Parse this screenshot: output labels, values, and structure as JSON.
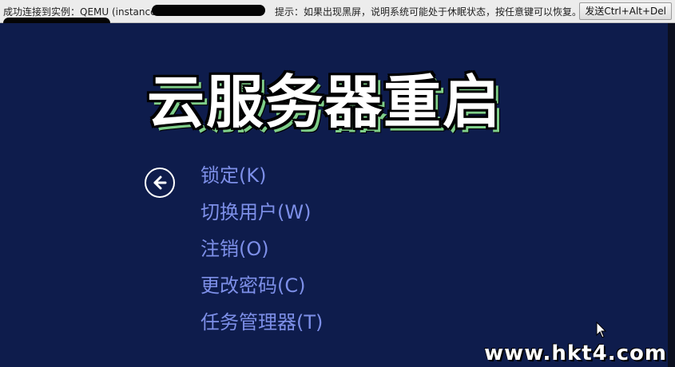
{
  "console_bar": {
    "status_text": "成功连接到实例：QEMU (instance",
    "hint_text": "提示：如果出现黑屏，说明系统可能处于休眠状态，按任意键可以恢复。",
    "send_cad_label": "发送Ctrl+Alt+Del"
  },
  "screen": {
    "title": "云服务器重启",
    "back_icon": "back-arrow-icon",
    "options": [
      {
        "label": "锁定(K)"
      },
      {
        "label": "切换用户(W)"
      },
      {
        "label": "注销(O)"
      },
      {
        "label": "更改密码(C)"
      },
      {
        "label": "任务管理器(T)"
      }
    ]
  },
  "watermark": "www.hkt4.com",
  "colors": {
    "background": "#0e1c4c",
    "option_text": "#7d8fe8",
    "console_bar": "#ececec"
  }
}
